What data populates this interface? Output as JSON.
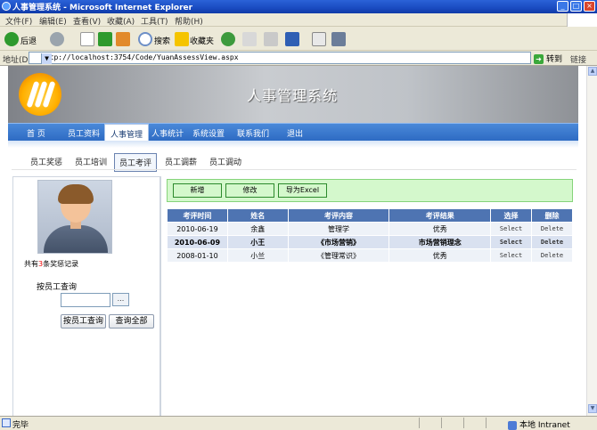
{
  "window": {
    "title": "人事管理系统 - Microsoft Internet Explorer",
    "controls": [
      "_",
      "□",
      "×"
    ]
  },
  "menubar": {
    "items": [
      "文件(F)",
      "编辑(E)",
      "查看(V)",
      "收藏(A)",
      "工具(T)",
      "帮助(H)"
    ]
  },
  "toolbar": {
    "back_label": "后退",
    "search_label": "搜索",
    "favorites_label": "收藏夹"
  },
  "address": {
    "label": "地址(D)",
    "url": "http://localhost:3754/Code/YuanAssessView.aspx",
    "go_label": "转到",
    "links_label": "链接"
  },
  "site": {
    "title": "人事管理系统"
  },
  "nav": {
    "items": [
      "首 页",
      "员工资料",
      "人事管理",
      "人事统计",
      "系统设置",
      "联系我们",
      "退出"
    ],
    "active": "人事管理"
  },
  "subtabs": {
    "items": [
      "员工奖惩",
      "员工培训",
      "员工考评",
      "员工调薪",
      "员工调动"
    ],
    "active": "员工考评"
  },
  "left": {
    "record_prefix": "共有",
    "record_count": "3",
    "record_suffix": "条奖惩记录",
    "search_label": "按员工查询",
    "search_value": "",
    "search_browse": "...",
    "query_employee_button": "按员工查询",
    "query_all_button": "查询全部"
  },
  "actions": {
    "add": "新增",
    "edit": "修改",
    "export": "导为Excel"
  },
  "grid": {
    "headers": [
      "考评时间",
      "姓名",
      "考评内容",
      "考评结果",
      "选择",
      "删除"
    ],
    "rows": [
      {
        "date": "2010-06-19",
        "name": "余鑫",
        "content": "管理学",
        "result": "优秀",
        "select": "Select",
        "delete": "Delete"
      },
      {
        "date": "2010-06-09",
        "name": "小王",
        "content": "《市场营销》",
        "result": "市场营销理念",
        "select": "Select",
        "delete": "Delete"
      },
      {
        "date": "2008-01-10",
        "name": "小兰",
        "content": "《管理常识》",
        "result": "优秀",
        "select": "Select",
        "delete": "Delete"
      }
    ]
  },
  "status": {
    "text": "完毕",
    "zone": "本地 Intranet"
  },
  "colors": {
    "title_bar": "#1a4bc1",
    "nav": "#2e6bc3",
    "grid_header": "#4e74b2",
    "action_bar": "#d4f8cc",
    "record_count": "#e00000"
  }
}
